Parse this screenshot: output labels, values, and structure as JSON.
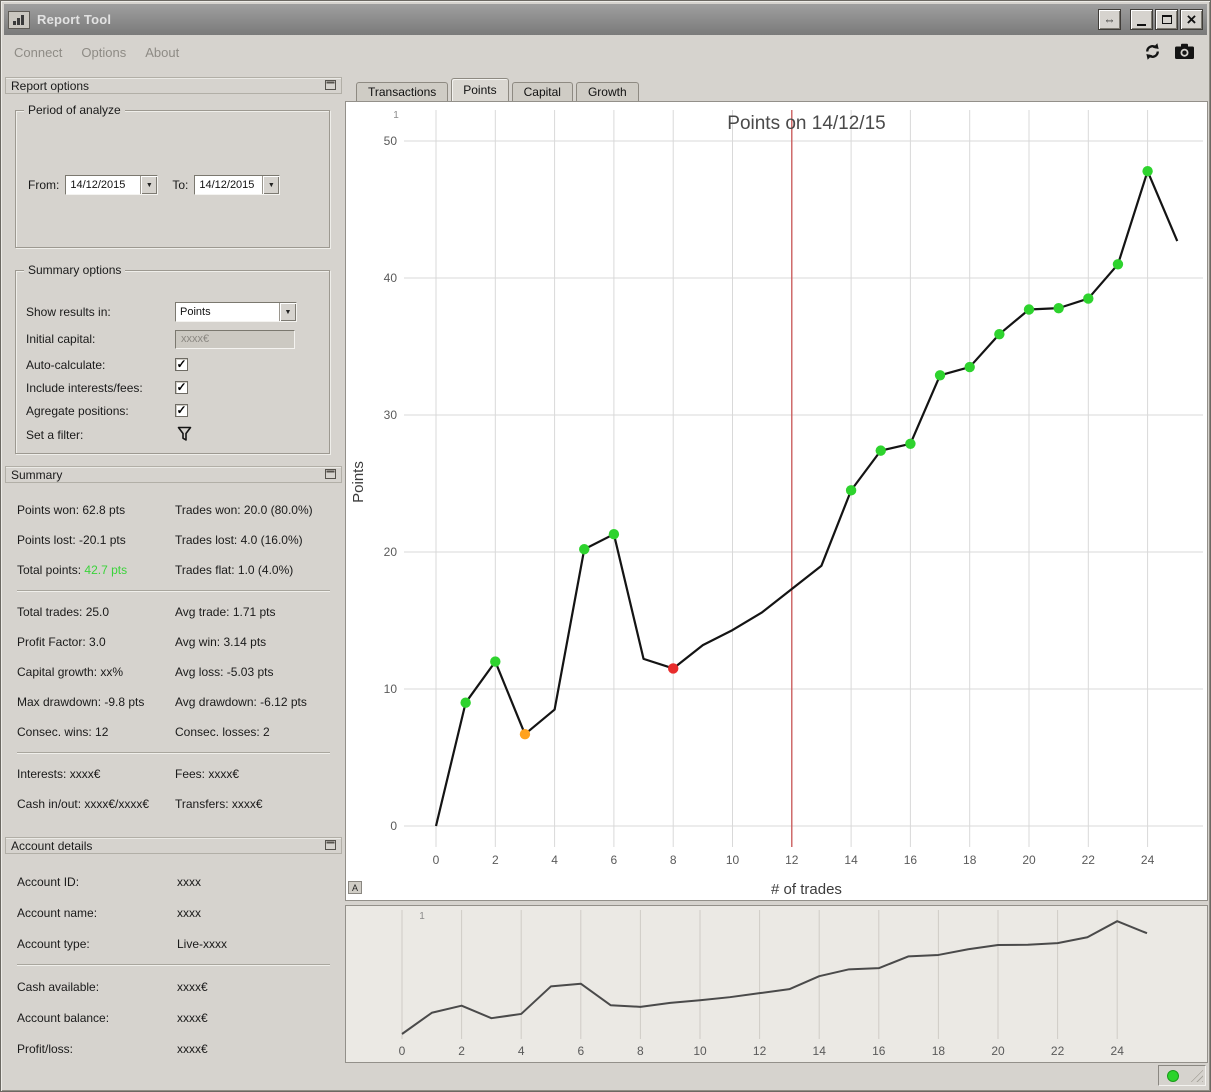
{
  "window": {
    "title": "Report Tool"
  },
  "icons": {
    "dock": "⇔",
    "close": "×",
    "dropdown": "▼",
    "check": "✓"
  },
  "menubar": {
    "items": [
      "Connect",
      "Options",
      "About"
    ]
  },
  "tabs": [
    {
      "label": "Transactions"
    },
    {
      "label": "Points"
    },
    {
      "label": "Capital"
    },
    {
      "label": "Growth"
    }
  ],
  "report_options": {
    "header": "Report options",
    "period": {
      "legend": "Period of analyze",
      "from_label": "From:",
      "from_value": "14/12/2015",
      "to_label": "To:",
      "to_value": "14/12/2015"
    },
    "summary_options": {
      "legend": "Summary options",
      "rows": [
        {
          "label": "Show results in:",
          "value": "Points"
        },
        {
          "label": "Initial capital:",
          "placeholder": "xxxx€"
        },
        {
          "label": "Auto-calculate:",
          "checked": true
        },
        {
          "label": "Include interests/fees:",
          "checked": true
        },
        {
          "label": "Agregate positions:",
          "checked": true
        },
        {
          "label": "Set a filter:"
        }
      ]
    }
  },
  "summary": {
    "header": "Summary",
    "group1": [
      {
        "left": "Points won: 62.8 pts",
        "right": "Trades won: 20.0 (80.0%)"
      },
      {
        "left": "Points lost: -20.1 pts",
        "right": "Trades lost: 4.0 (16.0%)"
      }
    ],
    "total_row": {
      "label": "Total points:",
      "value": "42.7 pts",
      "value_color": "#3bd33b",
      "right": "Trades flat: 1.0 (4.0%)"
    },
    "group2": [
      {
        "left": "Total trades: 25.0",
        "right": "Avg trade: 1.71 pts"
      },
      {
        "left": "Profit Factor: 3.0",
        "right": "Avg win: 3.14 pts"
      },
      {
        "left": "Capital growth: xx%",
        "right": "Avg loss: -5.03 pts"
      },
      {
        "left": "Max drawdown: -9.8 pts",
        "right": "Avg drawdown: -6.12 pts"
      },
      {
        "left": "Consec. wins: 12",
        "right": "Consec. losses: 2"
      }
    ],
    "group3": [
      {
        "left": "Interests: xxxx€",
        "right": "Fees: xxxx€"
      },
      {
        "left": "Cash in/out: xxxx€/xxxx€",
        "right": "Transfers: xxxx€"
      }
    ]
  },
  "account_details": {
    "header": "Account details",
    "rows_top": [
      {
        "label": "Account ID:",
        "value": "xxxx"
      },
      {
        "label": "Account name:",
        "value": "xxxx"
      },
      {
        "label": "Account type:",
        "value": "Live-xxxx"
      }
    ],
    "rows_bottom": [
      {
        "label": "Cash available:",
        "value": "xxxx€"
      },
      {
        "label": "Account balance:",
        "value": "xxxx€"
      },
      {
        "label": "Profit/loss:",
        "value": "xxxx€"
      }
    ]
  },
  "status": {
    "connection_color": "#2bd42b"
  },
  "chart_data": {
    "type": "line",
    "title": "Points on 14/12/15",
    "xlabel": "# of trades",
    "ylabel": "Points",
    "panel_label": "1",
    "autorange_label": "A",
    "x": [
      0,
      1,
      2,
      3,
      4,
      5,
      6,
      7,
      8,
      9,
      10,
      11,
      12,
      13,
      14,
      15,
      16,
      17,
      18,
      19,
      20,
      21,
      22,
      23,
      24,
      25
    ],
    "y": [
      0,
      9.0,
      12.0,
      6.7,
      8.5,
      20.2,
      21.3,
      12.2,
      11.5,
      13.2,
      14.3,
      15.6,
      17.3,
      19.0,
      24.5,
      27.4,
      27.9,
      32.9,
      33.5,
      35.9,
      37.7,
      37.8,
      38.5,
      41.0,
      47.8,
      42.7
    ],
    "markers": [
      {
        "x": 1,
        "color": "#2ed32e"
      },
      {
        "x": 2,
        "color": "#2ed32e"
      },
      {
        "x": 3,
        "color": "#ffa21f"
      },
      {
        "x": 5,
        "color": "#2ed32e"
      },
      {
        "x": 6,
        "color": "#2ed32e"
      },
      {
        "x": 8,
        "color": "#e82c2c"
      },
      {
        "x": 14,
        "color": "#2ed32e"
      },
      {
        "x": 15,
        "color": "#2ed32e"
      },
      {
        "x": 16,
        "color": "#2ed32e"
      },
      {
        "x": 17,
        "color": "#2ed32e"
      },
      {
        "x": 18,
        "color": "#2ed32e"
      },
      {
        "x": 19,
        "color": "#2ed32e"
      },
      {
        "x": 20,
        "color": "#2ed32e"
      },
      {
        "x": 21,
        "color": "#2ed32e"
      },
      {
        "x": 22,
        "color": "#2ed32e"
      },
      {
        "x": 23,
        "color": "#2ed32e"
      },
      {
        "x": 24,
        "color": "#2ed32e"
      }
    ],
    "xticks": [
      0,
      2,
      4,
      6,
      8,
      10,
      12,
      14,
      16,
      18,
      20,
      22,
      24
    ],
    "yticks": [
      0,
      10,
      20,
      30,
      40,
      50
    ],
    "xlim": [
      -1,
      26
    ],
    "ylim": [
      -1.6,
      52.2
    ],
    "vline_x": 12,
    "grid": true,
    "colors": {
      "line": "#141414",
      "grid": "#d9d9d9",
      "vline": "#c95555",
      "title": "#4a4a4a",
      "tick": "#5a5a5a",
      "axis_label": "#3c3c3c",
      "nav_line": "#4a4a4a",
      "nav_bg": "#ebe9e4",
      "nav_grid": "#cfccc6"
    },
    "navigator": {
      "panel_label": "1",
      "xticks": [
        0,
        2,
        4,
        6,
        8,
        10,
        12,
        14,
        16,
        18,
        20,
        22,
        24
      ]
    }
  }
}
